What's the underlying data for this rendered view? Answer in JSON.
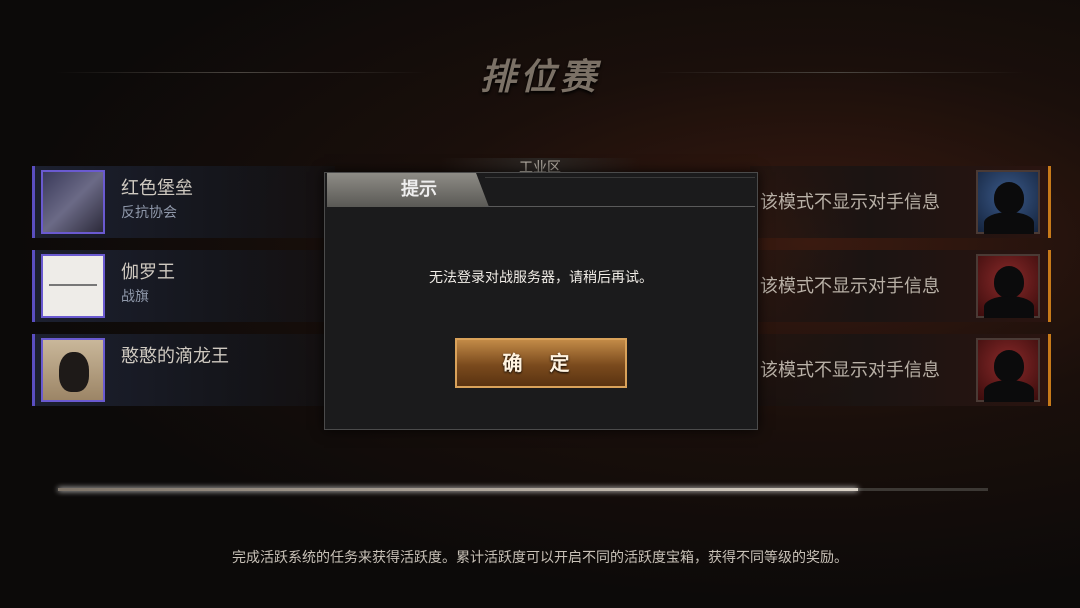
{
  "screen": {
    "title": "排位赛",
    "map_name": "工业区"
  },
  "players": [
    {
      "name": "红色堡垒",
      "guild": "反抗协会"
    },
    {
      "name": "伽罗王",
      "guild": "战旗"
    },
    {
      "name": "憨憨的滴龙王",
      "guild": ""
    }
  ],
  "opponents": [
    {
      "text": "该模式不显示对手信息",
      "avatar_color": "#1c3154"
    },
    {
      "text": "该模式不显示对手信息",
      "avatar_color": "#5a1414"
    },
    {
      "text": "该模式不显示对手信息",
      "avatar_color": "#5a1414"
    }
  ],
  "dialog": {
    "title": "提示",
    "message": "无法登录对战服务器，请稍后再试。",
    "confirm_label": "确 定"
  },
  "progress": {
    "fraction": 0.86
  },
  "tip": "完成活跃系统的任务来获得活跃度。累计活跃度可以开启不同的活跃度宝箱，获得不同等级的奖励。",
  "colors": {
    "ally_accent": "#5a4ec0",
    "enemy_accent": "#c77a1a",
    "button": "#9a6229"
  }
}
